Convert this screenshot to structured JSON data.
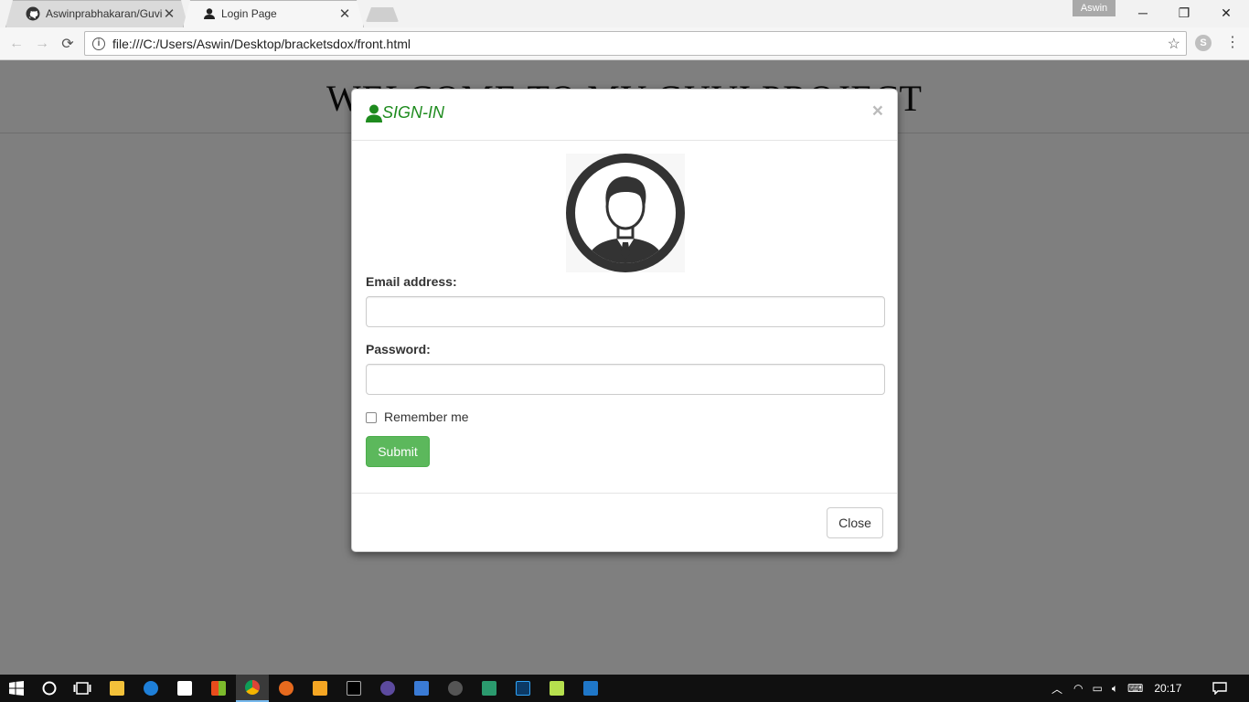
{
  "browser": {
    "tabs": [
      {
        "label": "Aswinprabhakaran/Guvi-",
        "icon": "github-icon",
        "active": false
      },
      {
        "label": "Login Page",
        "icon": "user-favicon-icon",
        "active": true
      }
    ],
    "profile_name": "Aswin",
    "url": "file:///C:/Users/Aswin/Desktop/bracketsdox/front.html"
  },
  "page": {
    "heading": "WELCOME TO MY GUVI PROJECT"
  },
  "modal": {
    "title": "SIGN-IN",
    "email_label": "Email address:",
    "email_value": "",
    "password_label": "Password:",
    "password_value": "",
    "remember_label": "Remember me",
    "remember_checked": false,
    "submit_label": "Submit",
    "close_label": "Close",
    "close_x": "×",
    "accent_color": "#1e8b1e",
    "submit_color": "#5cb85c"
  },
  "taskbar": {
    "apps": [
      "windows-start-icon",
      "cortana-icon",
      "task-view-icon",
      "file-explorer-icon",
      "edge-icon",
      "store-icon",
      "office-icon",
      "chrome-icon",
      "firefox-icon",
      "media-player-icon",
      "cmd-icon",
      "eclipse-icon",
      "keyboard-app-icon",
      "sublime-icon",
      "gitkraken-icon",
      "photoshop-icon",
      "notepad-icon",
      "brackets-icon"
    ],
    "time": "20:17"
  }
}
